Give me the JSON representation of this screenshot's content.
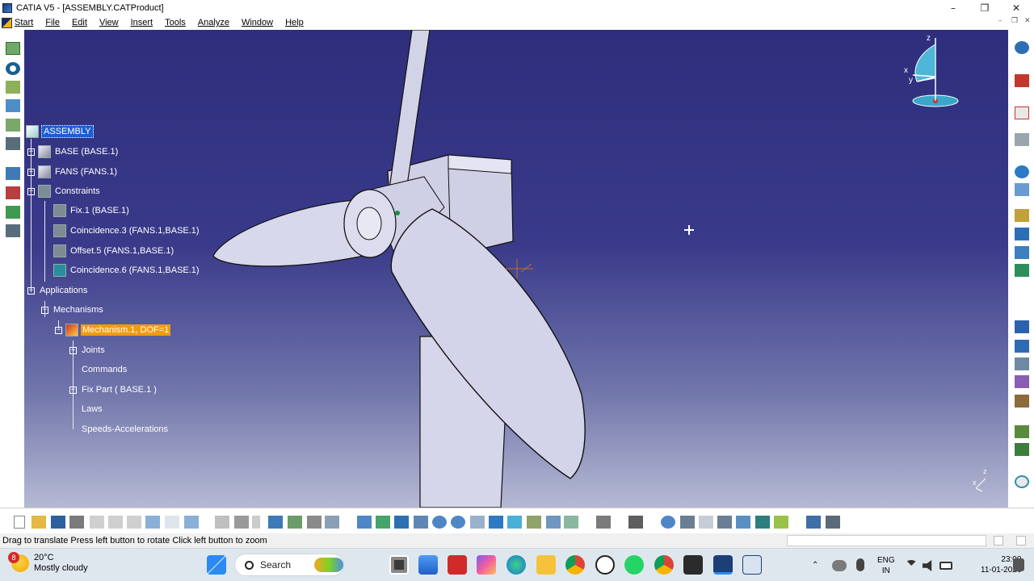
{
  "window": {
    "title": "CATIA V5 - [ASSEMBLY.CATProduct]",
    "minimize": "–",
    "maximize": "❐",
    "close": "✕"
  },
  "menu": {
    "start": "Start",
    "items": [
      "File",
      "Edit",
      "View",
      "Insert",
      "Tools",
      "Analyze",
      "Window",
      "Help"
    ]
  },
  "tree": {
    "root": "ASSEMBLY",
    "base": "BASE (BASE.1)",
    "fans": "FANS (FANS.1)",
    "constraints": "Constraints",
    "fix": "Fix.1 (BASE.1)",
    "coincidence3": "Coincidence.3 (FANS.1,BASE.1)",
    "offset5": "Offset.5 (FANS.1,BASE.1)",
    "coincidence6": "Coincidence.6 (FANS.1,BASE.1)",
    "applications": "Applications",
    "mechanisms": "Mechanisms",
    "mechanism1": "Mechanism.1, DOF=1",
    "joints": "Joints",
    "commands": "Commands",
    "fixpart": "Fix Part ( BASE.1 )",
    "laws": "Laws",
    "speeds": "Speeds-Accelerations"
  },
  "compass": {
    "x": "x",
    "y": "y",
    "z": "z"
  },
  "axis_small": {
    "x": "x",
    "z": "z"
  },
  "status_text": "Drag to translate  Press left button to rotate  Click left button to zoom",
  "taskbar": {
    "weather_temp": "20°C",
    "weather_desc": "Mostly cloudy",
    "weather_badge": "8",
    "search": "Search",
    "lang": "ENG",
    "region": "IN",
    "time": "23:00",
    "date": "11-01-2026"
  },
  "colors": {
    "viewport_top": "#2e2e7d",
    "viewport_bottom": "#b6b9d3",
    "selection": "#1c5cd6",
    "highlight": "#f29b0e",
    "part_fill": "#d8d8ec"
  }
}
